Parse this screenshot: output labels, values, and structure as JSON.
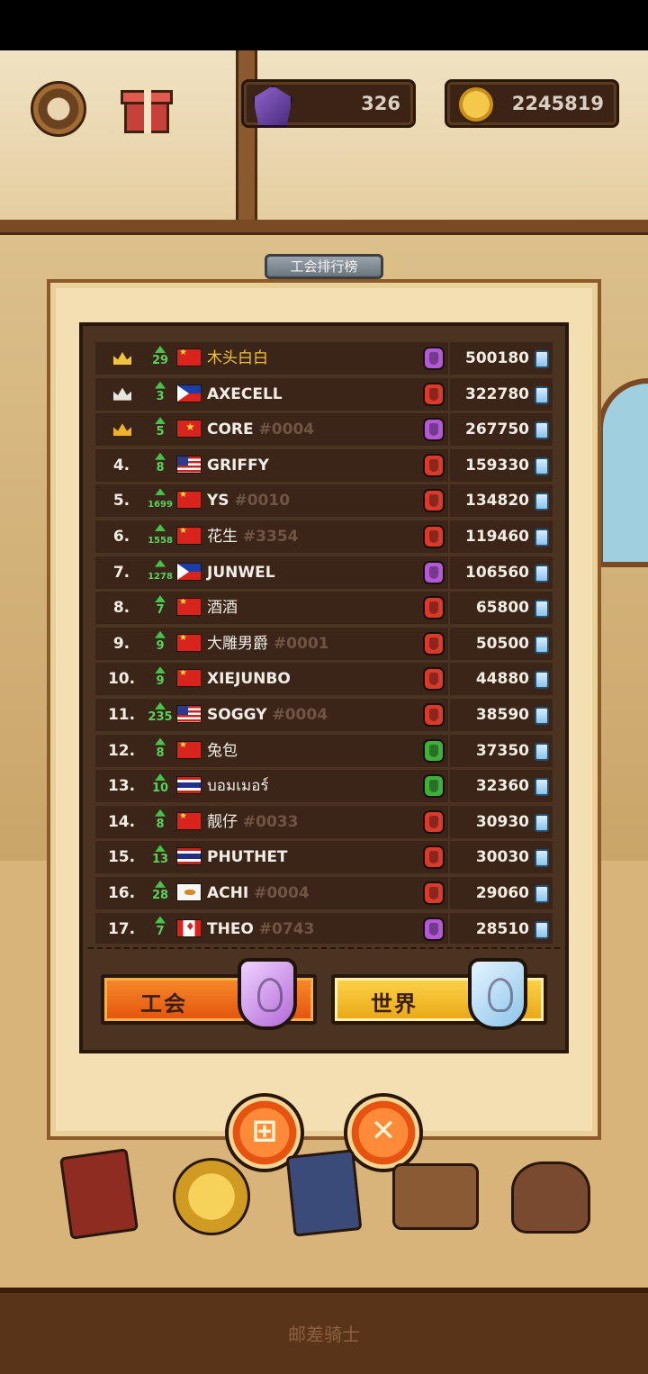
{
  "hud": {
    "gems": "326",
    "coins": "2245819"
  },
  "panel": {
    "title": "工会排行榜"
  },
  "rows": [
    {
      "rank": "",
      "crown": "gold",
      "up": "29",
      "flag": "cn",
      "name": "木头白白",
      "tag": "",
      "guild_color": "#b25ad6",
      "score": "500180"
    },
    {
      "rank": "",
      "crown": "silver",
      "up": "3",
      "flag": "ph",
      "name": "AXECELL",
      "tag": "",
      "guild_color": "#d83a2c",
      "score": "322780"
    },
    {
      "rank": "",
      "crown": "bronze",
      "up": "5",
      "flag": "vn",
      "name": "CORE",
      "tag": "#0004",
      "guild_color": "#b25ad6",
      "score": "267750"
    },
    {
      "rank": "4.",
      "crown": "",
      "up": "8",
      "flag": "us",
      "name": "GRIFFY",
      "tag": "",
      "guild_color": "#d83a2c",
      "score": "159330"
    },
    {
      "rank": "5.",
      "crown": "",
      "up": "1699",
      "flag": "cn",
      "name": "YS",
      "tag": "#0010",
      "guild_color": "#d83a2c",
      "score": "134820"
    },
    {
      "rank": "6.",
      "crown": "",
      "up": "1558",
      "flag": "cn",
      "name": "花生",
      "tag": "#3354",
      "guild_color": "#d83a2c",
      "score": "119460"
    },
    {
      "rank": "7.",
      "crown": "",
      "up": "1278",
      "flag": "ph",
      "name": "JUNWEL",
      "tag": "",
      "guild_color": "#b25ad6",
      "score": "106560"
    },
    {
      "rank": "8.",
      "crown": "",
      "up": "7",
      "flag": "cn",
      "name": "酒酒",
      "tag": "",
      "guild_color": "#d83a2c",
      "score": "65800"
    },
    {
      "rank": "9.",
      "crown": "",
      "up": "9",
      "flag": "cn",
      "name": "大雕男爵",
      "tag": "#0001",
      "guild_color": "#d83a2c",
      "score": "50500"
    },
    {
      "rank": "10.",
      "crown": "",
      "up": "9",
      "flag": "cn",
      "name": "XIEJUNBO",
      "tag": "",
      "guild_color": "#d83a2c",
      "score": "44880"
    },
    {
      "rank": "11.",
      "crown": "",
      "up": "235",
      "flag": "us",
      "name": "SOGGY",
      "tag": "#0004",
      "guild_color": "#d83a2c",
      "score": "38590"
    },
    {
      "rank": "12.",
      "crown": "",
      "up": "8",
      "flag": "cn",
      "name": "兔包",
      "tag": "",
      "guild_color": "#3fae3a",
      "score": "37350"
    },
    {
      "rank": "13.",
      "crown": "",
      "up": "10",
      "flag": "th",
      "name": "บอมเมอร์",
      "tag": "",
      "guild_color": "#3fae3a",
      "score": "32360"
    },
    {
      "rank": "14.",
      "crown": "",
      "up": "8",
      "flag": "cn",
      "name": "靓仔",
      "tag": "#0033",
      "guild_color": "#d83a2c",
      "score": "30930"
    },
    {
      "rank": "15.",
      "crown": "",
      "up": "13",
      "flag": "th",
      "name": "PHUTHET",
      "tag": "",
      "guild_color": "#d83a2c",
      "score": "30030"
    },
    {
      "rank": "16.",
      "crown": "",
      "up": "28",
      "flag": "cy",
      "name": "ACHI",
      "tag": "#0004",
      "guild_color": "#d83a2c",
      "score": "29060"
    },
    {
      "rank": "17.",
      "crown": "",
      "up": "7",
      "flag": "ca",
      "name": "THEO",
      "tag": "#0743",
      "guild_color": "#b25ad6",
      "score": "28510"
    }
  ],
  "tabs": {
    "guild_label": "工会",
    "world_label": "世界"
  },
  "buttons": {
    "rewards_icon": "gift-icon",
    "close_icon": "close-icon"
  },
  "footer": {
    "label": "邮差骑士"
  },
  "colors": {
    "crown_gold": "#f2c23c",
    "crown_silver": "#e8e4de",
    "crown_bronze": "#f0b12a"
  }
}
